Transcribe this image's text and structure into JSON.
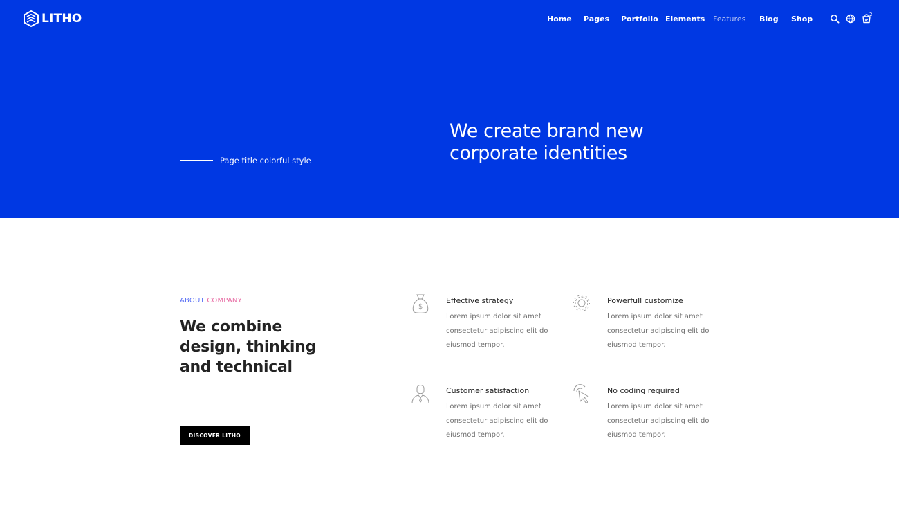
{
  "brand": {
    "name": "LITHO"
  },
  "nav": {
    "items": [
      {
        "label": "Home"
      },
      {
        "label": "Pages"
      },
      {
        "label": "Portfolio"
      },
      {
        "label": "Elements"
      },
      {
        "label": "Features",
        "active": true
      },
      {
        "label": "Blog"
      },
      {
        "label": "Shop"
      }
    ],
    "cart_count": "2",
    "icons": [
      "search-icon",
      "globe-icon",
      "cart-icon"
    ]
  },
  "hero": {
    "subtitle": "Page title colorful style",
    "title_line1": "We create brand new",
    "title_line2": "corporate identities"
  },
  "about": {
    "eyebrow_part1": "ABOUT",
    "eyebrow_part2": "COMPANY",
    "title_line1": "We combine",
    "title_line2": "design, thinking",
    "title_line3": "and technical",
    "button_label": "DISCOVER LITHO"
  },
  "features": [
    {
      "icon": "money-bag-icon",
      "title": "Effective strategy",
      "desc_line1": "Lorem ipsum dolor sit amet",
      "desc_line2": "consectetur adipiscing elit do",
      "desc_line3": "eiusmod tempor."
    },
    {
      "icon": "gear-icon",
      "title": "Powerfull customize",
      "desc_line1": "Lorem ipsum dolor sit amet",
      "desc_line2": "consectetur adipiscing elit do",
      "desc_line3": "eiusmod tempor."
    },
    {
      "icon": "user-icon",
      "title": "Customer satisfaction",
      "desc_line1": "Lorem ipsum dolor sit amet",
      "desc_line2": "consectetur adipiscing elit do",
      "desc_line3": "eiusmod tempor."
    },
    {
      "icon": "cursor-click-icon",
      "title": "No coding required",
      "desc_line1": "Lorem ipsum dolor sit amet",
      "desc_line2": "consectetur adipiscing elit do",
      "desc_line3": "eiusmod tempor."
    }
  ],
  "colors": {
    "hero_bg": "#0038e3",
    "eyebrow_blue": "#5d73f5",
    "eyebrow_pink": "#e86ea5",
    "button_bg": "#000000"
  }
}
